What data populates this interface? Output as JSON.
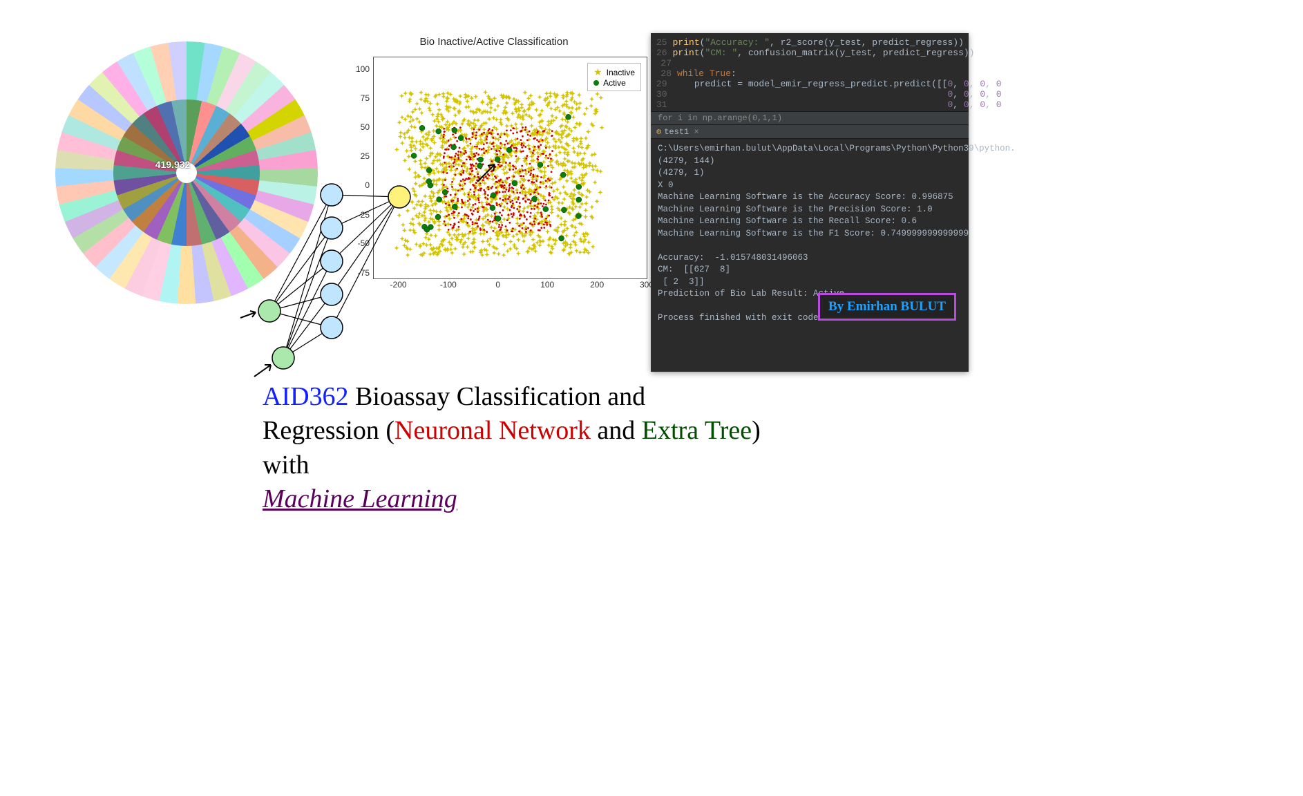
{
  "sunburst": {
    "center_label": "419.932"
  },
  "chart_data": {
    "type": "scatter",
    "title": "Bio Inactive/Active Classification",
    "xlabel": "",
    "ylabel": "",
    "xlim": [
      -250,
      300
    ],
    "ylim": [
      -80,
      110
    ],
    "x_ticks": [
      -200,
      -100,
      0,
      100,
      200,
      300
    ],
    "y_ticks": [
      -75,
      -50,
      -25,
      0,
      25,
      50,
      75,
      100
    ],
    "series": [
      {
        "name": "Inactive",
        "marker": "star",
        "color": "#d4c400",
        "count_approx": 2000
      },
      {
        "name": "Active",
        "marker": "circle",
        "color": "#0a7d0a",
        "count_approx": 40
      }
    ],
    "legend": [
      "Inactive",
      "Active"
    ]
  },
  "ide": {
    "code_lines": [
      {
        "n": "25",
        "t": "print(\"Accuracy: \", r2_score(y_test, predict_regress))"
      },
      {
        "n": "26",
        "t": "print(\"CM: \", confusion_matrix(y_test, predict_regress))"
      },
      {
        "n": "27",
        "t": ""
      },
      {
        "n": "28",
        "t": "while True:"
      },
      {
        "n": "29",
        "t": "    predict = model_emir_regress_predict.predict([[0, 0, 0, 0"
      },
      {
        "n": "30",
        "t": "                                                   0, 0, 0, 0"
      },
      {
        "n": "31",
        "t": "                                                   0, 0, 0, 0"
      }
    ],
    "breadcrumb": "for i in np.arange(0,1,1)",
    "tab_label": "test1",
    "console": [
      "C:\\Users\\emirhan.bulut\\AppData\\Local\\Programs\\Python\\Python39\\python.",
      "(4279, 144)",
      "(4279, 1)",
      "X 0",
      "Machine Learning Software is the Accuracy Score: 0.996875",
      "Machine Learning Software is the Precision Score: 1.0",
      "Machine Learning Software is the Recall Score: 0.6",
      "Machine Learning Software is the F1 Score: 0.749999999999999",
      "",
      "Accuracy:  -1.015748031496063",
      "CM:  [[627  8]",
      " [ 2  3]]",
      "Prediction of Bio Lab Result: Active",
      "",
      "Process finished with exit code 0"
    ]
  },
  "badge": {
    "text": "By Emirhan BULUT"
  },
  "title": {
    "blue": "AID362",
    "black1": " Bioassay Classification and Regression (",
    "red": "Neuronal Network",
    "black2": " and ",
    "green": "Extra Tree",
    "black3": ") with ",
    "ml": "Machine Learning"
  }
}
